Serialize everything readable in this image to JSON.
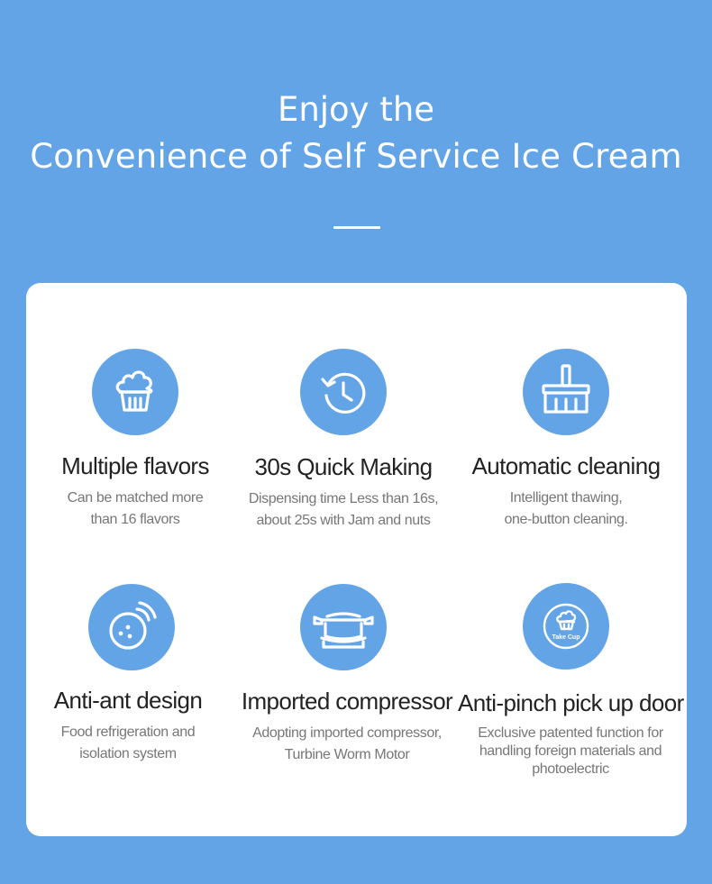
{
  "header": {
    "title_line1": "Enjoy the",
    "title_line2": "Convenience of Self Service Ice Cream"
  },
  "colors": {
    "background": "#63a4e6",
    "card": "#ffffff",
    "icon_circle": "#63a4e6",
    "title_text": "#222222",
    "desc_text": "#777777"
  },
  "features": [
    {
      "icon": "ice-cream-icon",
      "title": "Multiple flavors",
      "desc": [
        "Can be matched more",
        "than 16 flavors"
      ]
    },
    {
      "icon": "clock-icon",
      "title": "30s Quick Making",
      "desc": [
        "Dispensing time Less than 16s,",
        "about 25s with Jam and nuts"
      ]
    },
    {
      "icon": "broom-icon",
      "title": "Automatic cleaning",
      "desc": [
        "Intelligent thawing,",
        "one-button cleaning."
      ]
    },
    {
      "icon": "anti-ant-icon",
      "title": "Anti-ant design",
      "desc": [
        "Food refrigeration and",
        "isolation system"
      ]
    },
    {
      "icon": "compressor-icon",
      "title": "Imported compressor",
      "desc": [
        "Adopting imported compressor,",
        "Turbine Worm Motor"
      ]
    },
    {
      "icon": "take-cup-icon",
      "icon_label": "Take Cup",
      "title": "Anti-pinch pick up door",
      "desc": [
        "Exclusive patented function for",
        "handling foreign materials and",
        "photoelectric"
      ]
    }
  ]
}
